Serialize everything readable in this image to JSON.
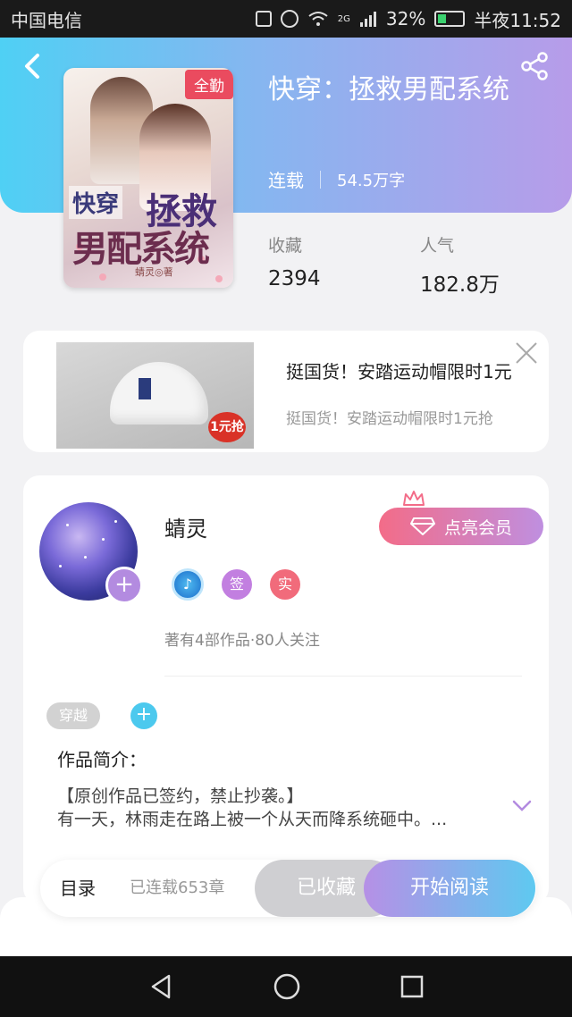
{
  "status_bar": {
    "carrier": "中国电信",
    "battery_percent": "32%",
    "time": "半夜11:52",
    "network": "2G"
  },
  "header": {
    "back_icon": "chevron-left-icon",
    "share_icon": "share-icon"
  },
  "book": {
    "cover_badge": "全勤",
    "cover_title_small": "快穿",
    "cover_title_large": "拯救",
    "cover_title_line2": "男配系统",
    "cover_author": "蜻灵◎著",
    "title": "快穿：拯救男配系统",
    "status": "连载",
    "word_count": "54.5万字",
    "stats": [
      {
        "label": "收藏",
        "value": "2394"
      },
      {
        "label": "人气",
        "value": "182.8万"
      }
    ]
  },
  "ad": {
    "title": "挺国货！安踏运动帽限时1元",
    "subtitle": "挺国货！安踏运动帽限时1元抢",
    "sticker": "1元抢",
    "close_icon": "close-icon"
  },
  "author": {
    "name": "蜻灵",
    "vip_button": "点亮会员",
    "badge_music": "♪",
    "badge_sign": "签",
    "badge_real": "实",
    "stats": "著有4部作品·80人关注",
    "tag": "穿越",
    "tag_add": "+",
    "avatar_add": "+"
  },
  "intro": {
    "label": "作品简介：",
    "line1": "【原创作品已签约，禁止抄袭。】",
    "line2": "有一天，林雨走在路上被一个从天而降系统砸中。..."
  },
  "bottom_bar": {
    "toc": "目录",
    "chapters": "已连载653章",
    "collected": "已收藏",
    "start_reading": "开始阅读"
  },
  "colors": {
    "accent_blue": "#4fd0f4",
    "accent_purple": "#b79ce9",
    "vip_pink": "#f36c88"
  }
}
